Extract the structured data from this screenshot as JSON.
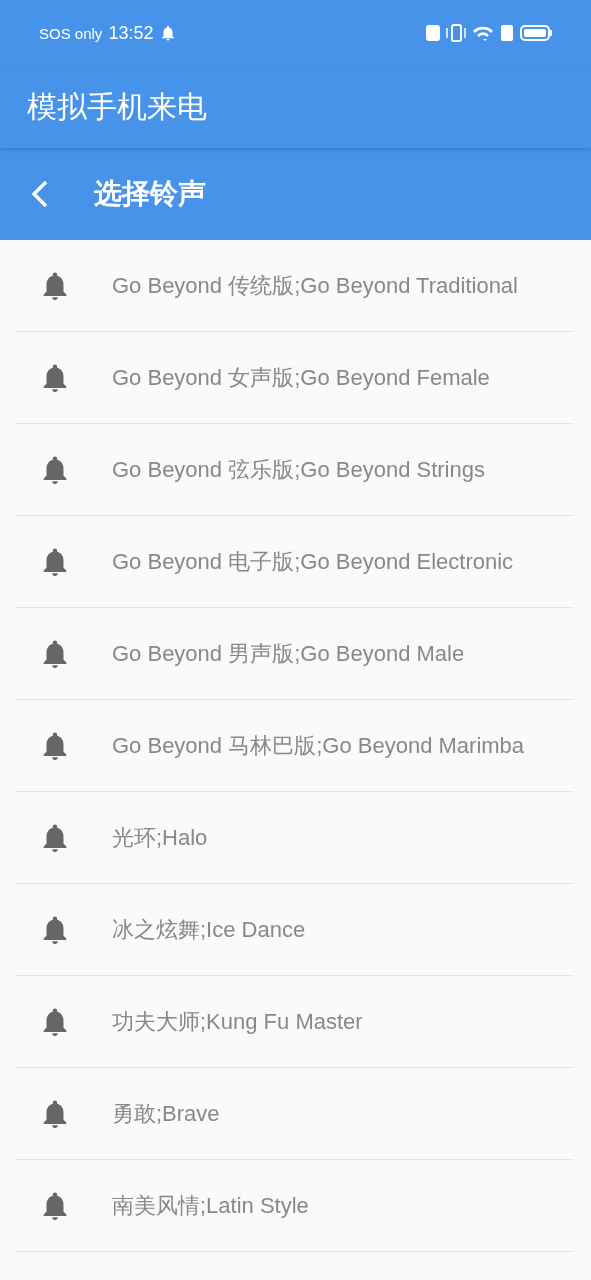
{
  "status_bar": {
    "carrier": "SOS only",
    "time": "13:52"
  },
  "app_bar": {
    "title": "模拟手机来电"
  },
  "sub_bar": {
    "title": "选择铃声"
  },
  "ringtones": [
    {
      "label": "Go Beyond 传统版;Go Beyond Traditional"
    },
    {
      "label": "Go Beyond 女声版;Go Beyond Female"
    },
    {
      "label": "Go Beyond 弦乐版;Go Beyond Strings"
    },
    {
      "label": "Go Beyond 电子版;Go Beyond Electronic"
    },
    {
      "label": "Go Beyond 男声版;Go Beyond Male"
    },
    {
      "label": "Go Beyond 马林巴版;Go Beyond Marimba"
    },
    {
      "label": "光环;Halo"
    },
    {
      "label": "冰之炫舞;Ice Dance"
    },
    {
      "label": "功夫大师;Kung Fu Master"
    },
    {
      "label": "勇敢;Brave"
    },
    {
      "label": "南美风情;Latin Style"
    }
  ]
}
